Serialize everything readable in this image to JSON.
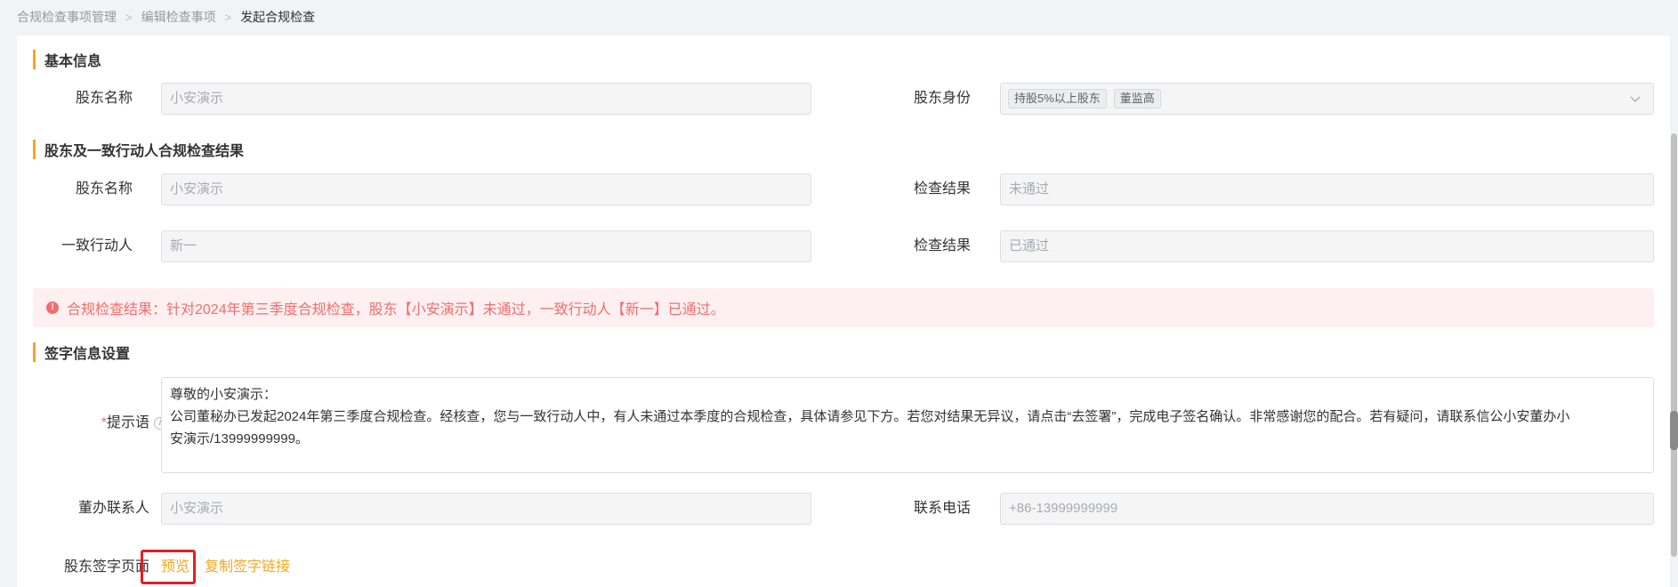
{
  "breadcrumb": {
    "items": [
      "合规检查事项管理",
      "编辑检查事项"
    ],
    "current": "发起合规检查"
  },
  "basic_info": {
    "title": "基本信息",
    "shareholder_name_label": "股东名称",
    "shareholder_name_value": "小安演示",
    "identity_label": "股东身份",
    "identity_tags": [
      "持股5%以上股东",
      "董监高"
    ]
  },
  "results": {
    "title": "股东及一致行动人合规检查结果",
    "rows": [
      {
        "name_label": "股东名称",
        "name_value": "小安演示",
        "result_label": "检查结果",
        "result_value": "未通过"
      },
      {
        "name_label": "一致行动人",
        "name_value": "新一",
        "result_label": "检查结果",
        "result_value": "已通过"
      }
    ],
    "alert_text": "合规检查结果：针对2024年第三季度合规检查，股东【小安演示】未通过，一致行动人【新一】已通过。"
  },
  "signature": {
    "title": "签字信息设置",
    "prompt_required": "*",
    "prompt_label": "提示语",
    "prompt_line1": "尊敬的小安演示：",
    "prompt_line2": "公司董秘办已发起2024年第三季度合规检查。经核查，您与一致行动人中，有人未通过本季度的合规检查，具体请参见下方。若您对结果无异议，请点击“去签署”，完成电子签名确认。非常感谢您的配合。若有疑问，请联系信公小安董办小",
    "prompt_line3": "安演示/13999999999。",
    "contact_label": "董办联系人",
    "contact_value": "小安演示",
    "phone_label": "联系电话",
    "phone_value": "+86-13999999999",
    "page_label": "股东签字页面",
    "preview_label": "预览",
    "copy_link_label": "复制签字链接"
  },
  "colors": {
    "accent": "#f5a623",
    "error": "#f56c6c",
    "highlight": "#e02020"
  }
}
